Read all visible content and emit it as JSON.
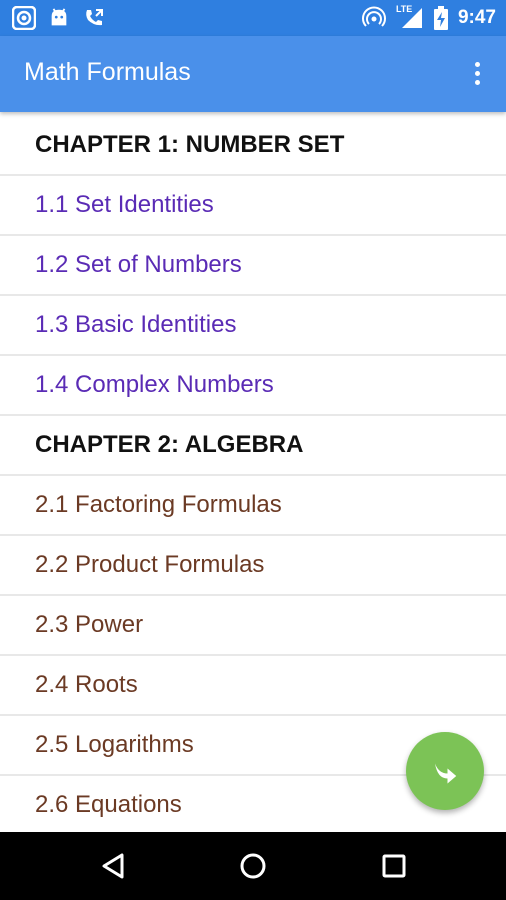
{
  "status_bar": {
    "time": "9:47",
    "network": "LTE",
    "icons": [
      "record-icon",
      "android-icon",
      "call-forward-icon",
      "hotspot-icon",
      "signal-icon",
      "battery-charging-icon"
    ]
  },
  "app_bar": {
    "title": "Math Formulas",
    "overflow_icon": "more-vert-icon"
  },
  "list": {
    "items": [
      {
        "type": "chapter",
        "label": "CHAPTER 1:  NUMBER SET"
      },
      {
        "type": "ch1",
        "label": "1.1 Set Identities"
      },
      {
        "type": "ch1",
        "label": "1.2 Set of Numbers"
      },
      {
        "type": "ch1",
        "label": "1.3 Basic Identities"
      },
      {
        "type": "ch1",
        "label": "1.4 Complex Numbers"
      },
      {
        "type": "chapter",
        "label": "CHAPTER 2: ALGEBRA"
      },
      {
        "type": "ch2",
        "label": "2.1 Factoring Formulas"
      },
      {
        "type": "ch2",
        "label": "2.2 Product Formulas"
      },
      {
        "type": "ch2",
        "label": "2.3 Power"
      },
      {
        "type": "ch2",
        "label": "2.4 Roots"
      },
      {
        "type": "ch2",
        "label": "2.5 Logarithms"
      },
      {
        "type": "ch2",
        "label": "2.6 Equations"
      }
    ]
  },
  "fab": {
    "icon": "share-arrow-icon"
  },
  "nav_bar": {
    "icons": [
      "back-icon",
      "home-icon",
      "recents-icon"
    ]
  },
  "colors": {
    "status_bar": "#2f7fe0",
    "app_bar": "#4a90ea",
    "chapter1_items": "#5a2bb5",
    "chapter2_items": "#6b3a24",
    "fab": "#7cc356"
  }
}
